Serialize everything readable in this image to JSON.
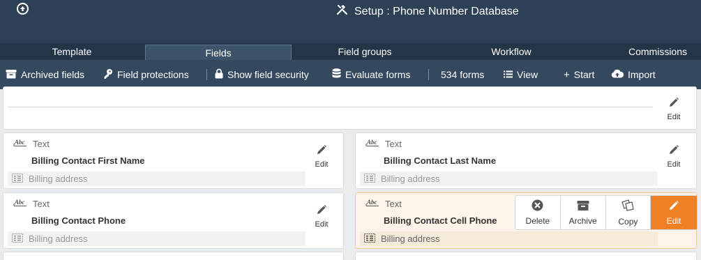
{
  "header": {
    "title": "Setup : Phone Number Database",
    "back_icon": "circle-arrow-up-icon",
    "title_icon": "tools-icon"
  },
  "tabs": [
    {
      "label": "Template"
    },
    {
      "label": "Fields",
      "active": true
    },
    {
      "label": "Field groups"
    },
    {
      "label": "Workflow"
    },
    {
      "label": "Commissions"
    }
  ],
  "toolbar": {
    "archived_fields": "Archived fields",
    "field_protections": "Field protections",
    "show_field_security": "Show field security",
    "evaluate_forms": "Evaluate forms",
    "forms_count": "534 forms",
    "view": "View",
    "start": "Start",
    "import": "Import"
  },
  "top_card": {
    "edit_label": "Edit"
  },
  "cards": [
    {
      "type": "Text",
      "name": "Billing Contact First Name",
      "group": "Billing address",
      "edit_label": "Edit"
    },
    {
      "type": "Text",
      "name": "Billing Contact Last Name",
      "group": "Billing address",
      "edit_label": "Edit"
    },
    {
      "type": "Text",
      "name": "Billing Contact Phone",
      "group": "Billing address",
      "edit_label": "Edit"
    },
    {
      "type": "Text",
      "name": "Billing Contact Cell Phone",
      "group": "Billing address"
    }
  ],
  "actions": {
    "delete": "Delete",
    "archive": "Archive",
    "copy": "Copy",
    "edit": "Edit"
  },
  "colors": {
    "header_bg": "#2e4056",
    "toolbar_bg": "#34495e",
    "accent": "#ef8025",
    "highlight_bg": "#fdf3e8"
  }
}
